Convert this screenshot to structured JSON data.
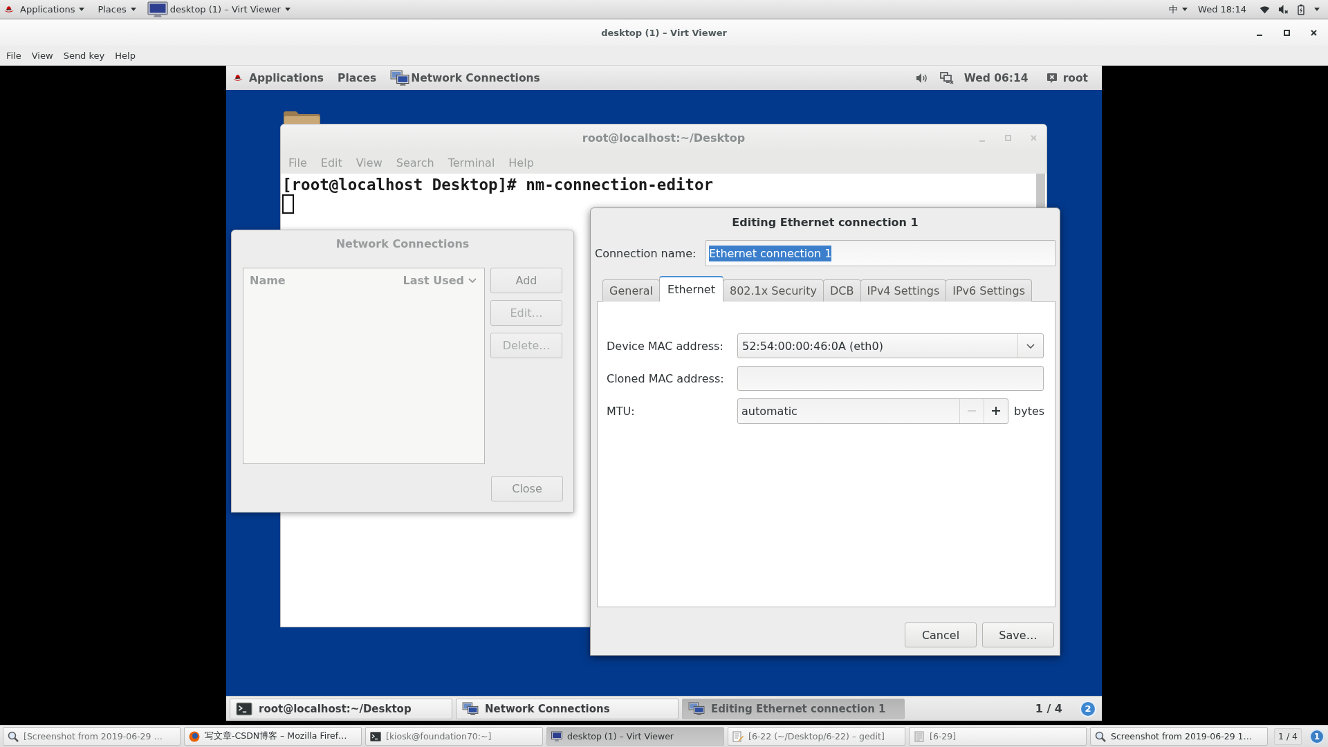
{
  "host_top_bar": {
    "menus": [
      {
        "label": "Applications"
      },
      {
        "label": "Places"
      }
    ],
    "window_menu": "desktop (1) – Virt Viewer",
    "input_method": "中",
    "clock": "Wed 18:14"
  },
  "viewer_window": {
    "title": "desktop (1) – Virt Viewer",
    "menus": [
      "File",
      "View",
      "Send key",
      "Help"
    ]
  },
  "guest": {
    "top_bar": {
      "menus": [
        "Applications",
        "Places"
      ],
      "app_menu": "Network Connections",
      "clock": "Wed 06:14",
      "user": "root"
    },
    "terminal": {
      "title": "root@localhost:~/Desktop",
      "menus": [
        "File",
        "Edit",
        "View",
        "Search",
        "Terminal",
        "Help"
      ],
      "lines": [
        "[root@localhost Desktop]# nm-connection-editor"
      ]
    },
    "connections_dialog": {
      "title": "Network Connections",
      "columns": [
        {
          "label": "Name",
          "sorted": false
        },
        {
          "label": "Last Used",
          "sorted": true
        }
      ],
      "buttons": [
        {
          "label": "Add",
          "disabled": false
        },
        {
          "label": "Edit…",
          "disabled": true
        },
        {
          "label": "Delete…",
          "disabled": true
        }
      ],
      "close_button": "Close"
    },
    "editor_dialog": {
      "title": "Editing Ethernet connection 1",
      "name_field": {
        "label": "Connection name:",
        "value": "Ethernet connection 1",
        "text_selected": true
      },
      "tabs": [
        {
          "label": "General",
          "selected": false
        },
        {
          "label": "Ethernet",
          "selected": true
        },
        {
          "label": "802.1x Security",
          "selected": false
        },
        {
          "label": "DCB",
          "selected": false
        },
        {
          "label": "IPv4 Settings",
          "selected": false
        },
        {
          "label": "IPv6 Settings",
          "selected": false
        }
      ],
      "fields": [
        {
          "kind": "combo",
          "label": "Device MAC address:",
          "value": "52:54:00:00:46:0A (eth0)"
        },
        {
          "kind": "entry",
          "label": "Cloned MAC address:"
        },
        {
          "kind": "spin",
          "label": "MTU:",
          "value": "automatic",
          "unit": "bytes",
          "decrease_disabled": true
        }
      ],
      "buttons": [
        "Cancel",
        "Save…"
      ]
    },
    "taskbar": {
      "items": [
        {
          "kind": "terminal",
          "label": "root@localhost:~/Desktop",
          "selected": false
        },
        {
          "kind": "network",
          "label": "Network Connections",
          "selected": false
        },
        {
          "kind": "network",
          "label": "Editing Ethernet connection 1",
          "selected": true
        }
      ],
      "workspace": "1 / 4",
      "notifications": "2"
    }
  },
  "host_taskbar": {
    "items": [
      {
        "kind": "screenshot",
        "label": "[Screenshot from 2019-06-29 …",
        "minimized": true,
        "selected": false
      },
      {
        "kind": "browser",
        "label": "写文章-CSDN博客 – Mozilla Firef…",
        "minimized": false,
        "selected": false
      },
      {
        "kind": "terminal",
        "label": "[kiosk@foundation70:~]",
        "minimized": true,
        "selected": false
      },
      {
        "kind": "viewer",
        "label": "desktop (1) – Virt Viewer",
        "minimized": false,
        "selected": true
      },
      {
        "kind": "editor",
        "label": "[6-22 (~/Desktop/6-22) – gedit]",
        "minimized": true,
        "selected": false
      },
      {
        "kind": "document",
        "label": "[6-29]",
        "minimized": true,
        "selected": false
      },
      {
        "kind": "screenshot",
        "label": "Screenshot from 2019-06-29 1…",
        "minimized": false,
        "selected": false
      }
    ],
    "workspace": "1 / 4",
    "notifications": "1"
  }
}
